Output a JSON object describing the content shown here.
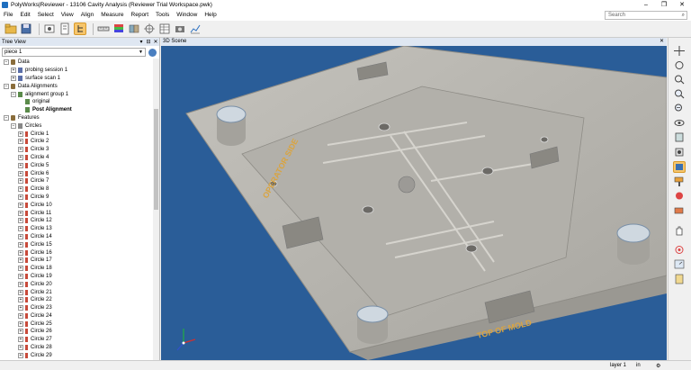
{
  "window": {
    "title": "PolyWorks|Reviewer - 13106 Cavity Analysis (Reviewer Trial Workspace.pwk)",
    "controls": [
      "–",
      "❐",
      "✕"
    ]
  },
  "menu": {
    "items": [
      "File",
      "Edit",
      "Select",
      "View",
      "Align",
      "Measure",
      "Report",
      "Tools",
      "Window",
      "Help"
    ],
    "search_placeholder": "Search"
  },
  "tree_view": {
    "title": "Tree View",
    "header_buttons": [
      "▾",
      "⊟",
      "✕"
    ],
    "piece": "piece 1",
    "rows": [
      {
        "label": "Data",
        "indent": 0,
        "expander": "−",
        "icon": "folder-icon",
        "bold": false
      },
      {
        "label": "probing session 1",
        "indent": 1,
        "expander": "+",
        "icon": "probe-icon",
        "bold": false
      },
      {
        "label": "surface scan 1",
        "indent": 1,
        "expander": "+",
        "icon": "scan-icon",
        "bold": false
      },
      {
        "label": "Data Alignments",
        "indent": 0,
        "expander": "−",
        "icon": "folder-icon",
        "bold": false
      },
      {
        "label": "alignment group 1",
        "indent": 1,
        "expander": "−",
        "icon": "alignment-icon",
        "bold": false
      },
      {
        "label": "original",
        "indent": 2,
        "expander": "",
        "icon": "alignment-icon",
        "bold": false
      },
      {
        "label": "Post Alignment",
        "indent": 2,
        "expander": "",
        "icon": "alignment-icon",
        "bold": true
      },
      {
        "label": "Features",
        "indent": 0,
        "expander": "−",
        "icon": "folder-icon",
        "bold": false
      },
      {
        "label": "Circles",
        "indent": 1,
        "expander": "−",
        "icon": "feature-icon",
        "bold": false
      },
      {
        "label": "Circle 1",
        "indent": 2,
        "expander": "+",
        "icon": "circle-icon",
        "bold": false
      },
      {
        "label": "Circle 2",
        "indent": 2,
        "expander": "+",
        "icon": "circle-icon",
        "bold": false
      },
      {
        "label": "Circle 3",
        "indent": 2,
        "expander": "+",
        "icon": "circle-icon",
        "bold": false
      },
      {
        "label": "Circle 4",
        "indent": 2,
        "expander": "+",
        "icon": "circle-icon",
        "bold": false
      },
      {
        "label": "Circle 5",
        "indent": 2,
        "expander": "+",
        "icon": "circle-icon",
        "bold": false
      },
      {
        "label": "Circle 6",
        "indent": 2,
        "expander": "+",
        "icon": "circle-icon",
        "bold": false
      },
      {
        "label": "Circle 7",
        "indent": 2,
        "expander": "+",
        "icon": "circle-icon",
        "bold": false
      },
      {
        "label": "Circle 8",
        "indent": 2,
        "expander": "+",
        "icon": "circle-icon",
        "bold": false
      },
      {
        "label": "Circle 9",
        "indent": 2,
        "expander": "+",
        "icon": "circle-icon",
        "bold": false
      },
      {
        "label": "Circle 10",
        "indent": 2,
        "expander": "+",
        "icon": "circle-icon",
        "bold": false
      },
      {
        "label": "Circle 11",
        "indent": 2,
        "expander": "+",
        "icon": "circle-icon",
        "bold": false
      },
      {
        "label": "Circle 12",
        "indent": 2,
        "expander": "+",
        "icon": "circle-icon",
        "bold": false
      },
      {
        "label": "Circle 13",
        "indent": 2,
        "expander": "+",
        "icon": "circle-icon",
        "bold": false
      },
      {
        "label": "Circle 14",
        "indent": 2,
        "expander": "+",
        "icon": "circle-icon",
        "bold": false
      },
      {
        "label": "Circle 15",
        "indent": 2,
        "expander": "+",
        "icon": "circle-icon",
        "bold": false
      },
      {
        "label": "Circle 16",
        "indent": 2,
        "expander": "+",
        "icon": "circle-icon",
        "bold": false
      },
      {
        "label": "Circle 17",
        "indent": 2,
        "expander": "+",
        "icon": "circle-icon",
        "bold": false
      },
      {
        "label": "Circle 18",
        "indent": 2,
        "expander": "+",
        "icon": "circle-icon",
        "bold": false
      },
      {
        "label": "Circle 19",
        "indent": 2,
        "expander": "+",
        "icon": "circle-icon",
        "bold": false
      },
      {
        "label": "Circle 20",
        "indent": 2,
        "expander": "+",
        "icon": "circle-icon",
        "bold": false
      },
      {
        "label": "Circle 21",
        "indent": 2,
        "expander": "+",
        "icon": "circle-icon",
        "bold": false
      },
      {
        "label": "Circle 22",
        "indent": 2,
        "expander": "+",
        "icon": "circle-icon",
        "bold": false
      },
      {
        "label": "Circle 23",
        "indent": 2,
        "expander": "+",
        "icon": "circle-icon",
        "bold": false
      },
      {
        "label": "Circle 24",
        "indent": 2,
        "expander": "+",
        "icon": "circle-icon",
        "bold": false
      },
      {
        "label": "Circle 25",
        "indent": 2,
        "expander": "+",
        "icon": "circle-icon",
        "bold": false
      },
      {
        "label": "Circle 26",
        "indent": 2,
        "expander": "+",
        "icon": "circle-icon",
        "bold": false
      },
      {
        "label": "Circle 27",
        "indent": 2,
        "expander": "+",
        "icon": "circle-icon",
        "bold": false
      },
      {
        "label": "Circle 28",
        "indent": 2,
        "expander": "+",
        "icon": "circle-icon",
        "bold": false
      },
      {
        "label": "Circle 29",
        "indent": 2,
        "expander": "+",
        "icon": "circle-icon",
        "bold": false
      }
    ]
  },
  "scene": {
    "title": "3D Scene",
    "close": "✕",
    "text_operator_side": "OPERATOR SIDE",
    "text_top_of_mold": "TOP OF MOLD",
    "colors": {
      "background": "#2a5d98",
      "part": "#b8b6b0",
      "part_edge": "#8e8c86",
      "engraving": "#d9a441"
    }
  },
  "toolbar": {
    "icons": [
      "open-file-icon",
      "save-icon",
      "screenshot-icon",
      "report-icon",
      "tree-toggle-icon",
      "measure-icon",
      "color-map-icon",
      "compare-icon",
      "align-icon",
      "table-icon",
      "camera-icon",
      "chart-icon"
    ]
  },
  "right_toolbar": {
    "icons": [
      "translate-icon",
      "rotate-icon",
      "zoom-icon",
      "zoom-in-icon",
      "zoom-out-icon",
      "visibility-icon",
      "view-front-icon",
      "view-cube-icon",
      "shading-icon",
      "paint-icon",
      "color-icon",
      "eraser-icon",
      "hand-icon",
      "target-icon",
      "gauge-icon",
      "clipboard-icon"
    ]
  },
  "status": {
    "layer": "layer 1",
    "units": "in",
    "extra": "⚙"
  }
}
